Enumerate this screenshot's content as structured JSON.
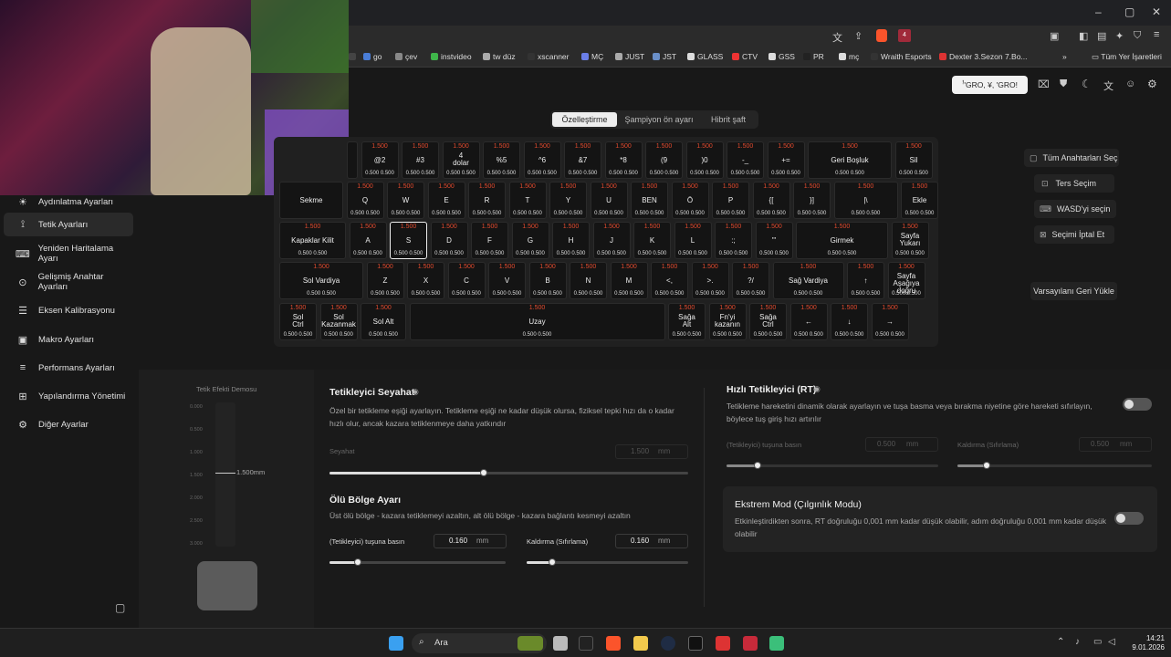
{
  "browser": {
    "addr_icons": [
      "translate-icon",
      "share-icon",
      "brave-shield-icon",
      "brave-rewards-icon"
    ],
    "rewards_badge": "4",
    "title_controls": [
      "–",
      "▢",
      "✕"
    ],
    "bookmarks": [
      {
        "label": "",
        "c": "#444"
      },
      {
        "label": "go",
        "c": "#4a7dd6"
      },
      {
        "label": "çev",
        "c": "#888"
      },
      {
        "label": "instvideo",
        "c": "#3fb54a"
      },
      {
        "label": "tw düz",
        "c": "#aaa"
      },
      {
        "label": "xscanner",
        "c": "#333"
      },
      {
        "label": "MÇ",
        "c": "#6a7ee8"
      },
      {
        "label": "JUST",
        "c": "#aaa"
      },
      {
        "label": "JST",
        "c": "#6a8fc8"
      },
      {
        "label": "GLASS",
        "c": "#ddd"
      },
      {
        "label": "CTV",
        "c": "#e33"
      },
      {
        "label": "GSS",
        "c": "#ddd"
      },
      {
        "label": "PR",
        "c": "#222"
      },
      {
        "label": "mç",
        "c": "#ddd"
      },
      {
        "label": "Wraith Esports",
        "c": "#333"
      },
      {
        "label": "Dexter 3.Sezon 7.Bo...",
        "c": "#d33"
      }
    ],
    "bookmarks_more": "»",
    "all_bookmarks": "Tüm Yer İşaretleri"
  },
  "header": {
    "profile_button": "ꜝ'GRO, ¥, 'GRO!"
  },
  "sidebar": {
    "items": [
      {
        "icon": "lightbulb-icon",
        "glyph": "☀",
        "label": "Aydınlatma Ayarları"
      },
      {
        "icon": "trigger-icon",
        "glyph": "⟟",
        "label": "Tetik Ayarları"
      },
      {
        "icon": "remap-icon",
        "glyph": "⌨",
        "label": "Yeniden Haritalama Ayarı"
      },
      {
        "icon": "advanced-key-icon",
        "glyph": "⊙",
        "label": "Gelişmiş Anahtar Ayarları"
      },
      {
        "icon": "axis-icon",
        "glyph": "☰",
        "label": "Eksen Kalibrasyonu"
      },
      {
        "icon": "macro-icon",
        "glyph": "▣",
        "label": "Makro Ayarları"
      },
      {
        "icon": "performance-icon",
        "glyph": "≡",
        "label": "Performans Ayarları"
      },
      {
        "icon": "config-icon",
        "glyph": "⊞",
        "label": "Yapılandırma Yönetimi"
      },
      {
        "icon": "settings-icon",
        "glyph": "⚙",
        "label": "Diğer Ayarlar"
      }
    ],
    "active": 1,
    "collapse_icon": "▢"
  },
  "tabs": [
    "Özelleştirme",
    "Şampiyon ön ayarı",
    "Hibrit şaft"
  ],
  "keyboard": {
    "rows": [
      [
        {
          "l": "",
          "v": "",
          "b": "",
          "w": 12
        },
        {
          "l": "@2",
          "v": "1.500",
          "b": "0.500 0.500"
        },
        {
          "l": "#3",
          "v": "1.500",
          "b": "0.500 0.500"
        },
        {
          "l": "4\ndolar",
          "v": "1.500",
          "b": "0.500 0.500"
        },
        {
          "l": "%5",
          "v": "1.500",
          "b": "0.500 0.500"
        },
        {
          "l": "^6",
          "v": "1.500",
          "b": "0.500 0.500"
        },
        {
          "l": "&7",
          "v": "1.500",
          "b": "0.500 0.500"
        },
        {
          "l": "*8",
          "v": "1.500",
          "b": "0.500 0.500"
        },
        {
          "l": "(9",
          "v": "1.500",
          "b": "0.500 0.500"
        },
        {
          "l": ")0",
          "v": "1.500",
          "b": "0.500 0.500"
        },
        {
          "l": "-_",
          "v": "1.500",
          "b": "0.500 0.500"
        },
        {
          "l": "+=",
          "v": "1.500",
          "b": "0.500 0.500"
        },
        {
          "l": "Geri Boşluk",
          "v": "1.500",
          "b": "0.500 0.500",
          "w": 92
        },
        {
          "l": "Sil",
          "v": "1.500",
          "b": "0.500 0.500"
        }
      ],
      [
        {
          "l": "Sekme",
          "v": "",
          "b": "",
          "w": 70
        },
        {
          "l": "Q",
          "v": "1.500",
          "b": "0.500 0.500"
        },
        {
          "l": "W",
          "v": "1.500",
          "b": "0.500 0.500"
        },
        {
          "l": "E",
          "v": "1.500",
          "b": "0.500 0.500"
        },
        {
          "l": "R",
          "v": "1.500",
          "b": "0.500 0.500"
        },
        {
          "l": "T",
          "v": "1.500",
          "b": "0.500 0.500"
        },
        {
          "l": "Y",
          "v": "1.500",
          "b": "0.500 0.500"
        },
        {
          "l": "U",
          "v": "1.500",
          "b": "0.500 0.500"
        },
        {
          "l": "BEN",
          "v": "1.500",
          "b": "0.500 0.500"
        },
        {
          "l": "Ö",
          "v": "1.500",
          "b": "0.500 0.500"
        },
        {
          "l": "P",
          "v": "1.500",
          "b": "0.500 0.500"
        },
        {
          "l": "{[",
          "v": "1.500",
          "b": "0.500 0.500"
        },
        {
          "l": "}]",
          "v": "1.500",
          "b": "0.500 0.500"
        },
        {
          "l": "|\\",
          "v": "1.500",
          "b": "0.500 0.500",
          "w": 70
        },
        {
          "l": "Ekle",
          "v": "1.500",
          "b": "0.500 0.500"
        }
      ],
      [
        {
          "l": "Kapaklar Kilit",
          "v": "1.500",
          "b": "0.500 0.500",
          "w": 73
        },
        {
          "l": "A",
          "v": "1.500",
          "b": "0.500 0.500"
        },
        {
          "l": "S",
          "v": "1.500",
          "b": "0.500 0.500",
          "sel": true
        },
        {
          "l": "D",
          "v": "1.500",
          "b": "0.500 0.500"
        },
        {
          "l": "F",
          "v": "1.500",
          "b": "0.500 0.500"
        },
        {
          "l": "G",
          "v": "1.500",
          "b": "0.500 0.500"
        },
        {
          "l": "H",
          "v": "1.500",
          "b": "0.500 0.500"
        },
        {
          "l": "J",
          "v": "1.500",
          "b": "0.500 0.500"
        },
        {
          "l": "K",
          "v": "1.500",
          "b": "0.500 0.500"
        },
        {
          "l": "L",
          "v": "1.500",
          "b": "0.500 0.500"
        },
        {
          "l": ":;",
          "v": "1.500",
          "b": "0.500 0.500"
        },
        {
          "l": "\"'",
          "v": "1.500",
          "b": "0.500 0.500"
        },
        {
          "l": "Girmek",
          "v": "1.500",
          "b": "0.500 0.500",
          "w": 101
        },
        {
          "l": "Sayfa\nYukarı",
          "v": "1.500",
          "b": "0.500 0.500"
        }
      ],
      [
        {
          "l": "Sol Vardiya",
          "v": "1.500",
          "b": "0.500 0.500",
          "w": 92
        },
        {
          "l": "Z",
          "v": "1.500",
          "b": "0.500 0.500"
        },
        {
          "l": "X",
          "v": "1.500",
          "b": "0.500 0.500"
        },
        {
          "l": "C",
          "v": "1.500",
          "b": "0.500 0.500"
        },
        {
          "l": "V",
          "v": "1.500",
          "b": "0.500 0.500"
        },
        {
          "l": "B",
          "v": "1.500",
          "b": "0.500 0.500"
        },
        {
          "l": "N",
          "v": "1.500",
          "b": "0.500 0.500"
        },
        {
          "l": "M",
          "v": "1.500",
          "b": "0.500 0.500"
        },
        {
          "l": "<,",
          "v": "1.500",
          "b": "0.500 0.500"
        },
        {
          "l": ">.",
          "v": "1.500",
          "b": "0.500 0.500"
        },
        {
          "l": "?/",
          "v": "1.500",
          "b": "0.500 0.500"
        },
        {
          "l": "Sağ Vardiya",
          "v": "1.500",
          "b": "0.500 0.500",
          "w": 78
        },
        {
          "l": "↑",
          "v": "1.500",
          "b": "0.500 0.500"
        },
        {
          "l": "Sayfa\nAşağıya\ndoğru",
          "v": "1.500",
          "b": "0.500 0.500"
        }
      ],
      [
        {
          "l": "Sol\nCtrl",
          "v": "1.500",
          "b": "0.500 0.500"
        },
        {
          "l": "Sol\nKazanmak",
          "v": "1.500",
          "b": "0.500 0.500"
        },
        {
          "l": "Sol Alt",
          "v": "1.500",
          "b": "0.500 0.500",
          "w": 50
        },
        {
          "l": "Uzay",
          "v": "1.500",
          "b": "0.500 0.500",
          "w": 280
        },
        {
          "l": "Sağa\nAlt",
          "v": "1.500",
          "b": "0.500 0.500"
        },
        {
          "l": "Fn'yi\nkazanın",
          "v": "1.500",
          "b": "0.500 0.500"
        },
        {
          "l": "Sağa\nCtrl",
          "v": "1.500",
          "b": "0.500 0.500"
        },
        {
          "l": "←",
          "v": "1.500",
          "b": "0.500 0.500"
        },
        {
          "l": "↓",
          "v": "1.500",
          "b": "0.500 0.500"
        },
        {
          "l": "→",
          "v": "1.500",
          "b": "0.500 0.500"
        }
      ]
    ]
  },
  "right_actions": {
    "select_all": "Tüm Anahtarları Seç",
    "invert": "Ters Seçim",
    "wasd": "WASD'yi seçin",
    "cancel": "Seçimi İptal Et",
    "reset": "Varsayılanı Geri Yükle"
  },
  "demo": {
    "title": "Tetik Efekti Demosu",
    "ticks": [
      "0.000",
      "0.500",
      "1.000",
      "1.500",
      "2.000",
      "2.500",
      "3.000"
    ],
    "marker": "1.500mm",
    "level": 0.5
  },
  "travel": {
    "title": "Tetikleyici Seyahat",
    "desc": "Özel bir tetikleme eşiği ayarlayın. Tetikleme eşiği ne kadar düşük olursa, fiziksel tepki hızı da o kadar hızlı olur, ancak kazara tetiklenmeye daha yatkındır",
    "label": "Seyahat",
    "value": "1.500",
    "unit": "mm",
    "frac": 0.43
  },
  "deadzone": {
    "title": "Ölü Bölge Ayarı",
    "desc": "Üst ölü bölge - kazara tetiklemeyi azaltın, alt ölü bölge - kazara bağlantı kesmeyi azaltın",
    "press_label": "(Tetikleyici) tuşuna basın",
    "press_value": "0.160",
    "release_label": "Kaldırma (Sıfırlama)",
    "release_value": "0.160",
    "unit": "mm",
    "press_frac": 0.16,
    "release_frac": 0.16
  },
  "rt": {
    "title": "Hızlı Tetikleyici (RT)",
    "desc": "Tetikleme hareketini dinamik olarak ayarlayın ve tuşa basma veya bırakma niyetine göre hareketi sıfırlayın, böylece tuş giriş hızı artırılır",
    "press_label": "(Tetikleyici) tuşuna basın",
    "press_value": "0.500",
    "release_label": "Kaldırma (Sıfırlama)",
    "release_value": "0.500",
    "unit": "mm",
    "enabled": false
  },
  "extreme": {
    "title": "Ekstrem Mod (Çılgınlık Modu)",
    "desc": "Etkinleştirdikten sonra, RT doğruluğu 0,001 mm kadar düşük olabilir, adım doğruluğu 0,001 mm kadar düşük olabilir",
    "enabled": false
  },
  "taskbar": {
    "search": "Ara",
    "time": "14:21",
    "date": "9.01.2026"
  },
  "colors": {
    "accent": "#e24b2f"
  }
}
